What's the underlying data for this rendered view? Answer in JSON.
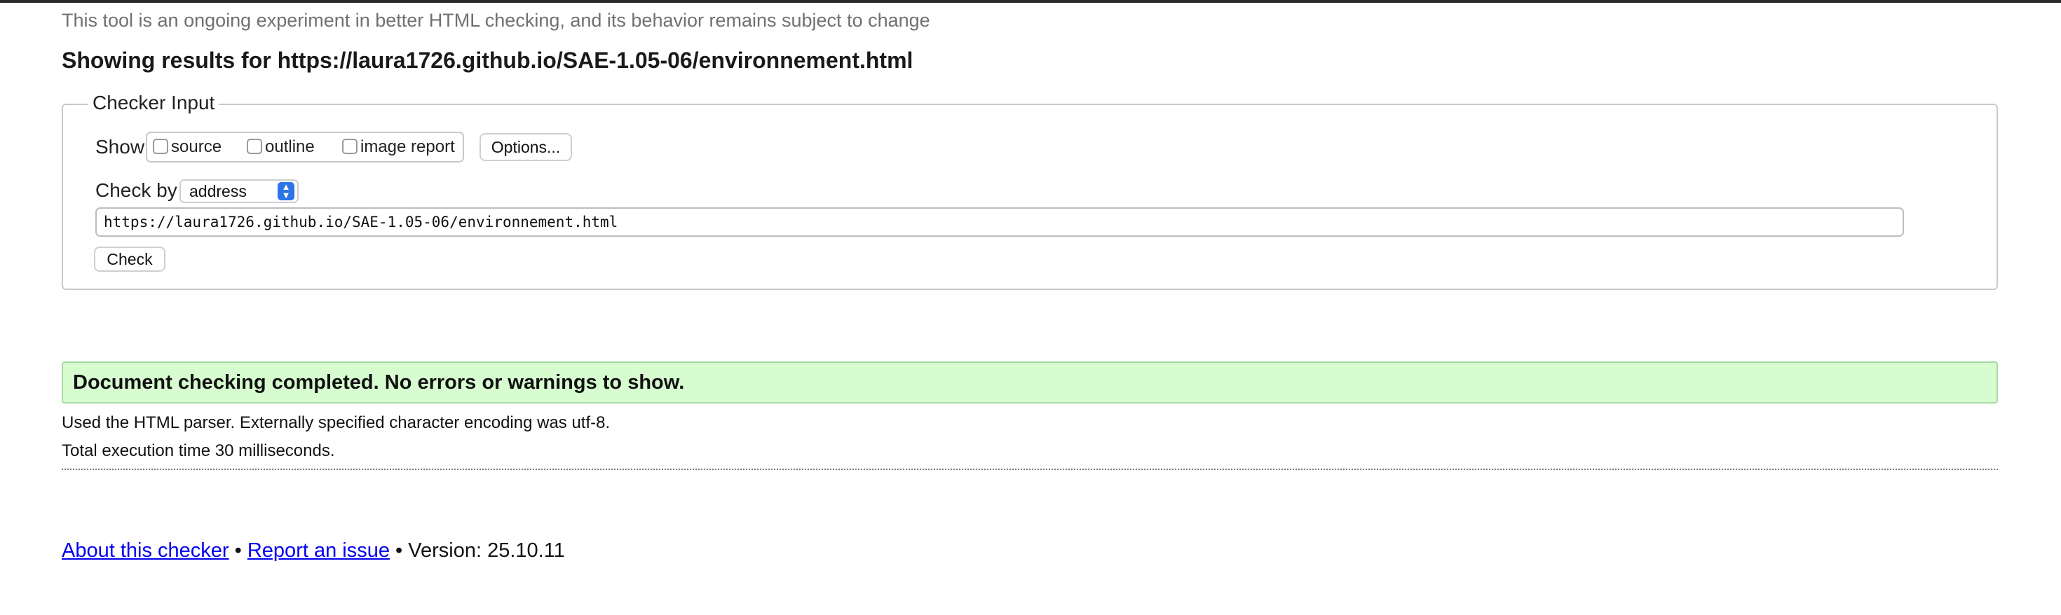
{
  "notice": "This tool is an ongoing experiment in better HTML checking, and its behavior remains subject to change",
  "heading": {
    "prefix": "Showing results for",
    "url": "https://laura1726.github.io/SAE-1.05-06/environnement.html"
  },
  "checker_input": {
    "legend": "Checker Input",
    "show_label": "Show",
    "show_options": [
      {
        "label": "source",
        "checked": false
      },
      {
        "label": "outline",
        "checked": false
      },
      {
        "label": "image report",
        "checked": false
      }
    ],
    "options_button": "Options...",
    "check_by_label": "Check by",
    "check_by_value": "address",
    "url_value": "https://laura1726.github.io/SAE-1.05-06/environnement.html",
    "check_button": "Check"
  },
  "result": {
    "message": "Document checking completed. No errors or warnings to show.",
    "parser_info": "Used the HTML parser. Externally specified character encoding was utf-8.",
    "execution_time": "Total execution time 30 milliseconds."
  },
  "footer": {
    "about_link": "About this checker",
    "separator": "•",
    "report_link": "Report an issue",
    "version": "Version: 25.10.11"
  },
  "colors": {
    "success_background": "#d6fcd0",
    "link": "#0000ee",
    "select_arrow": "#2b75e6"
  }
}
